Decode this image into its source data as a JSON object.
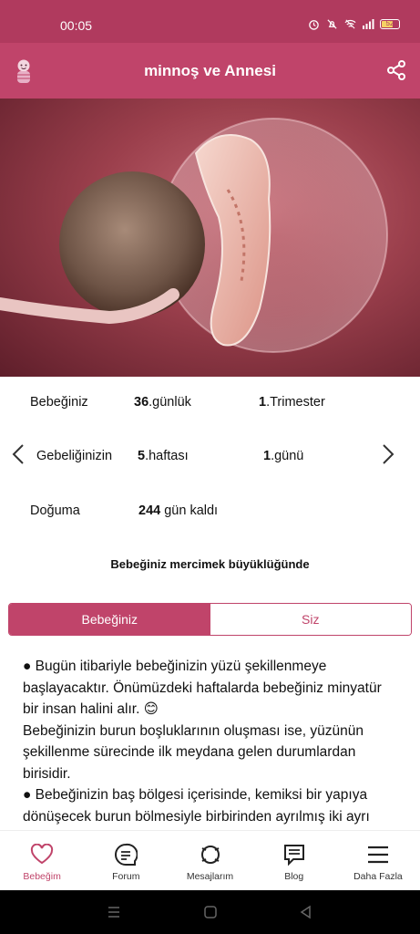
{
  "status_bar": {
    "time": "00:05",
    "battery": "52"
  },
  "app_bar": {
    "title": "minnoş ve Annesi"
  },
  "info": {
    "row1": {
      "label": "Bebeğiniz",
      "value_num": "36",
      "value_unit": ".günlük",
      "extra_num": "1",
      "extra_unit": ".Trimester"
    },
    "row2": {
      "label": "Gebeliğinizin",
      "value_num": "5",
      "value_unit": ".haftası",
      "extra_num": "1",
      "extra_unit": ".günü"
    },
    "row3": {
      "label": "Doğuma",
      "value_num": "244",
      "value_unit": " gün kaldı"
    }
  },
  "size_caption": "Bebeğiniz mercimek büyüklüğünde",
  "tabs": [
    {
      "label": "Bebeğiniz",
      "active": true
    },
    {
      "label": "Siz",
      "active": false
    }
  ],
  "content": {
    "p1": "● Bugün itibariyle bebeğinizin yüzü şekillenmeye başlayacaktır. Önümüzdeki haftalarda bebeğiniz minyatür bir insan halini alır. 😊",
    "p2": "Bebeğinizin burun boşluklarının oluşması ise, yüzünün şekillenme sürecinde ilk meydana gelen durumlardan birisidir.",
    "p3": "● Bebeğinizin baş bölgesi içerisinde, kemiksi bir yapıya dönüşecek burun bölmesiyle birbirinden ayrılmış iki ayrı"
  },
  "bottom_nav": [
    {
      "label": "Bebeğim",
      "icon": "heart-icon",
      "active": true
    },
    {
      "label": "Forum",
      "icon": "chat-list-icon",
      "active": false
    },
    {
      "label": "Mesajlarım",
      "icon": "messages-icon",
      "active": false
    },
    {
      "label": "Blog",
      "icon": "blog-icon",
      "active": false
    },
    {
      "label": "Daha Fazla",
      "icon": "menu-icon",
      "active": false
    }
  ],
  "colors": {
    "primary": "#c0446a",
    "status": "#b03a5e"
  }
}
